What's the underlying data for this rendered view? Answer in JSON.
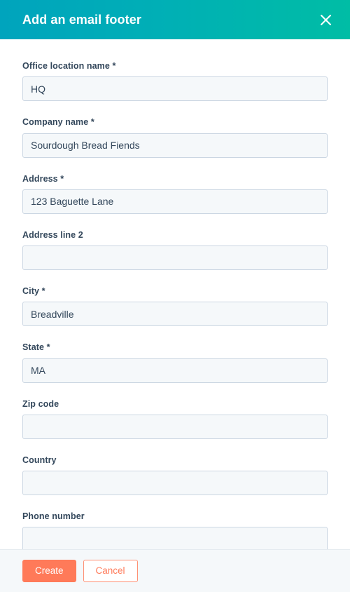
{
  "header": {
    "title": "Add an email footer",
    "close_icon": "close-icon",
    "gradient_start": "#00A4BD",
    "gradient_end": "#00BDA5"
  },
  "form": {
    "fields": [
      {
        "name": "office-location-name",
        "label": "Office location name",
        "required": true,
        "required_marker": "*",
        "value": "HQ",
        "placeholder": ""
      },
      {
        "name": "company-name",
        "label": "Company name",
        "required": true,
        "required_marker": "*",
        "value": "Sourdough Bread Fiends",
        "placeholder": ""
      },
      {
        "name": "address",
        "label": "Address",
        "required": true,
        "required_marker": "*",
        "value": "123 Baguette Lane",
        "placeholder": ""
      },
      {
        "name": "address-line-2",
        "label": "Address line 2",
        "required": false,
        "required_marker": "",
        "value": "",
        "placeholder": ""
      },
      {
        "name": "city",
        "label": "City",
        "required": true,
        "required_marker": "*",
        "value": "Breadville",
        "placeholder": ""
      },
      {
        "name": "state",
        "label": "State",
        "required": true,
        "required_marker": "*",
        "value": "MA",
        "placeholder": ""
      },
      {
        "name": "zip-code",
        "label": "Zip code",
        "required": false,
        "required_marker": "",
        "value": "",
        "placeholder": ""
      },
      {
        "name": "country",
        "label": "Country",
        "required": false,
        "required_marker": "",
        "value": "",
        "placeholder": ""
      },
      {
        "name": "phone-number",
        "label": "Phone number",
        "required": false,
        "required_marker": "",
        "value": "",
        "placeholder": ""
      }
    ]
  },
  "footer": {
    "create_label": "Create",
    "cancel_label": "Cancel",
    "primary_color": "#FF7A59",
    "background": "#F5F8FA"
  }
}
